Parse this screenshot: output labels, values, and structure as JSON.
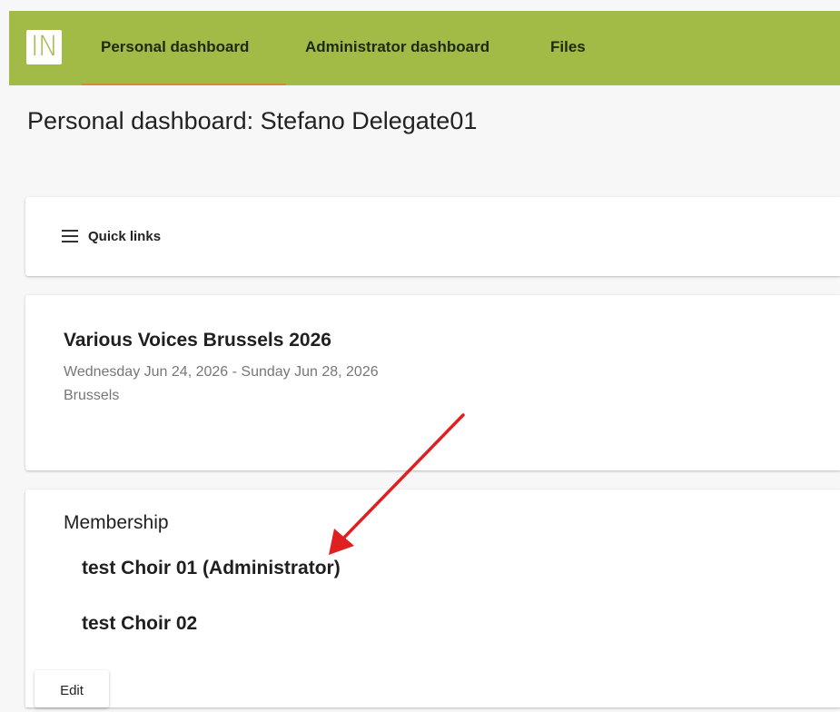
{
  "header": {
    "logo_text": "IN",
    "nav": [
      {
        "label": "Personal dashboard",
        "active": true
      },
      {
        "label": "Administrator dashboard",
        "active": false
      },
      {
        "label": "Files",
        "active": false
      }
    ],
    "brand_color": "#a2bb46",
    "active_underline_color": "#d98a2b"
  },
  "page": {
    "title": "Personal dashboard: Stefano Delegate01"
  },
  "quick_links": {
    "icon": "menu-icon",
    "label": "Quick links"
  },
  "event": {
    "title": "Various Voices Brussels 2026",
    "dates": "Wednesday Jun 24, 2026 - Sunday Jun 28, 2026",
    "location": "Brussels"
  },
  "membership": {
    "title": "Membership",
    "choirs": [
      {
        "label": "test Choir 01 (Administrator)"
      },
      {
        "label": "test Choir 02"
      }
    ],
    "edit_label": "Edit"
  },
  "annotation": {
    "arrow_color": "#e02020"
  }
}
